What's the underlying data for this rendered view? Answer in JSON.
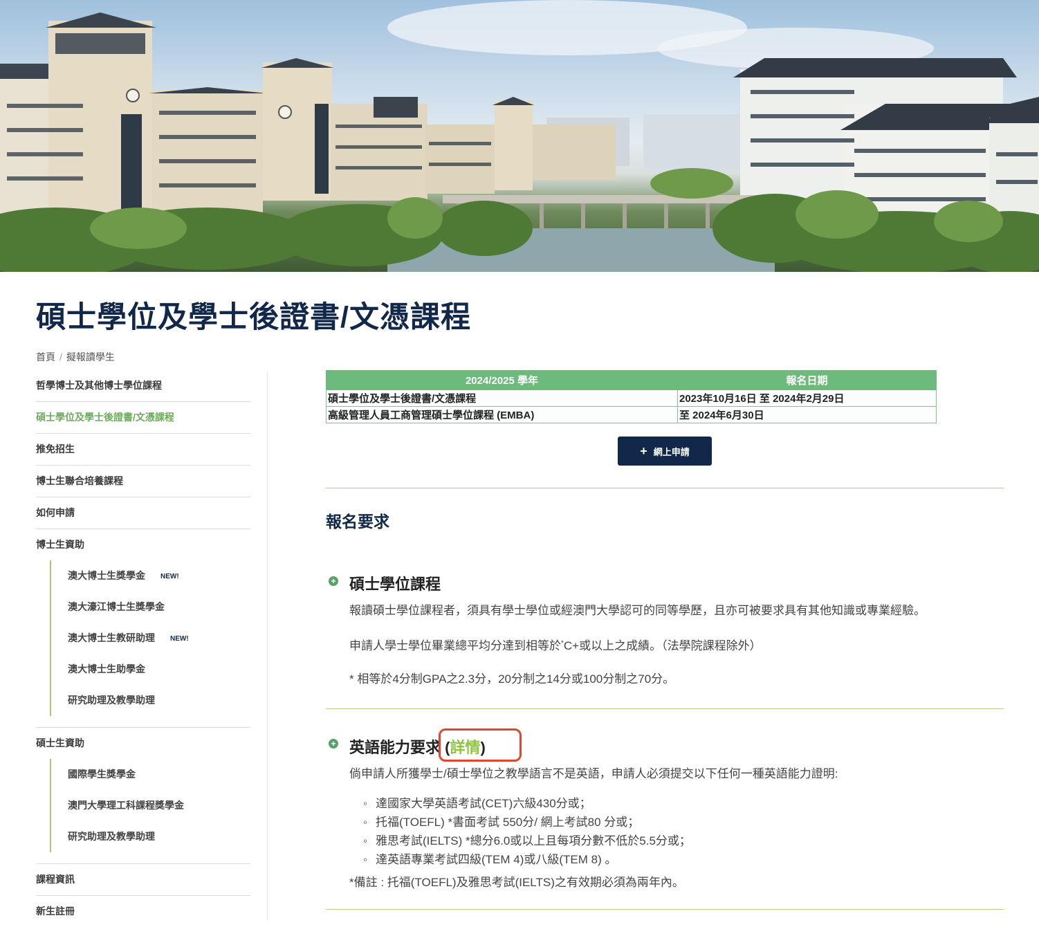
{
  "page": {
    "title": "碩士學位及學士後證書/文憑課程",
    "hero_alt": "campus-banner"
  },
  "breadcrumb": {
    "home": "首頁",
    "separator": "/",
    "current": "擬報讀學生"
  },
  "sidebar": {
    "items": [
      {
        "label": "哲學博士及其他博士學位課程",
        "active": false
      },
      {
        "label": "碩士學位及學士後證書/文憑課程",
        "active": true
      },
      {
        "label": "推免招生",
        "active": false
      },
      {
        "label": "博士生聯合培養課程",
        "active": false
      },
      {
        "label": "如何申請",
        "active": false
      },
      {
        "label": "博士生資助",
        "active": false
      }
    ],
    "phd_funding_sub": [
      {
        "label": "澳大博士生獎學金",
        "badge": "NEW!"
      },
      {
        "label": "澳大濠江博士生獎學金",
        "badge": ""
      },
      {
        "label": "澳大博士生教研助理",
        "badge": "NEW!"
      },
      {
        "label": "澳大博士生助學金",
        "badge": ""
      },
      {
        "label": "研究助理及教學助理",
        "badge": ""
      }
    ],
    "master_funding": "碩士生資助",
    "master_funding_sub": [
      {
        "label": "國際學生獎學金"
      },
      {
        "label": "澳門大學理工科課程獎學金"
      },
      {
        "label": "研究助理及教學助理"
      }
    ],
    "bottom_items": [
      {
        "label": "課程資訊"
      },
      {
        "label": "新生註冊"
      }
    ]
  },
  "dates_table": {
    "headers": [
      "2024/2025 學年",
      "報名日期"
    ],
    "rows": [
      [
        "碩士學位及學士後證書/文憑課程",
        "2023年10月16日 至 2024年2月29日"
      ],
      [
        "高級管理人員工商管理碩士學位課程 (EMBA)",
        "至 2024年6月30日"
      ]
    ]
  },
  "apply_button": {
    "icon": "plus-icon",
    "label": "網上申請"
  },
  "requirements": {
    "heading": "報名要求",
    "master": {
      "title": "碩士學位課程",
      "p1": "報讀碩士學位課程者，須具有學士學位或經澳門大學認可的同等學歷，且亦可被要求具有其他知識或專業經驗。",
      "p2_before": "申請人學士學位畢業總平均分達到相等於",
      "p2_sup": "*",
      "p2_after": "C+或以上之成績。（法學院課程除外）",
      "p3": "* 相等於4分制GPA之2.3分，20分制之14分或100分制之70分。"
    },
    "english": {
      "title": "英語能力要求",
      "open_paren": " (",
      "detail_link": "詳情",
      "close_paren": ")",
      "intro": "倘申請人所獲學士/碩士學位之教學語言不是英語，申請人必須提交以下任何一種英語能力證明:",
      "list": [
        "達國家大學英語考試(CET)六級430分或；",
        "托福(TOEFL) *書面考試 550分/ 網上考試80 分或；",
        "雅思考試(IELTS) *總分6.0或以上且每項分數不低於5.5分或；",
        "達英語專業考試四級(TEM 4)或八級(TEM 8) 。"
      ],
      "note": "*備註 : 托福(TOEFL)及雅思考試(IELTS)之有效期必須為兩年內。"
    }
  },
  "colors": {
    "navy": "#12284b",
    "green_active": "#6cac5b",
    "table_header": "#6dbb7c",
    "link_green": "#8dc63f",
    "highlight_red": "#e0462f"
  }
}
